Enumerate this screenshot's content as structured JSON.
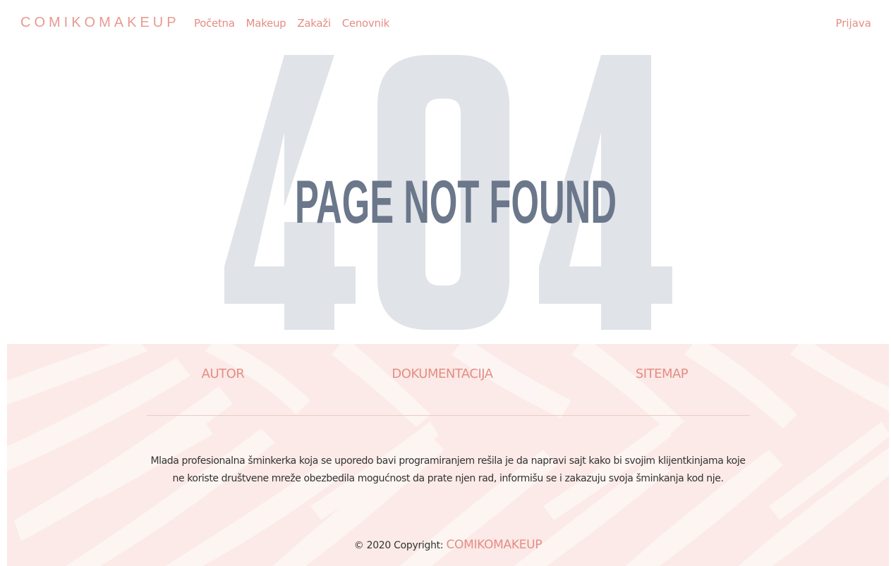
{
  "navbar": {
    "brand": "COMIKOMAKEUP",
    "links": [
      "Početna",
      "Makeup",
      "Zakaži",
      "Cenovnik"
    ],
    "login": "Prijava"
  },
  "error": {
    "code": "404",
    "message": "PAGE NOT FOUND"
  },
  "footer": {
    "links": [
      "AUTOR",
      "DOKUMENTACIJA",
      "SITEMAP"
    ],
    "description": "Mlada profesionalna šminkerka koja se uporedo bavi programiranjem rešila je da napravi sajt kako bi svojim klijentkinjama koje ne koriste društvene mreže obezbedila mogućnost da prate njen rad, informišu se i zakazuju svoja šminkanja kod nje.",
    "copyright_prefix": "© 2020 Copyright:",
    "copyright_brand": "COMIKOMAKEUP"
  },
  "colors": {
    "accent": "#e58d84",
    "big_404": "#e0e3e8",
    "not_found_text": "#6b778a",
    "footer_bg": "#fbeae7"
  }
}
